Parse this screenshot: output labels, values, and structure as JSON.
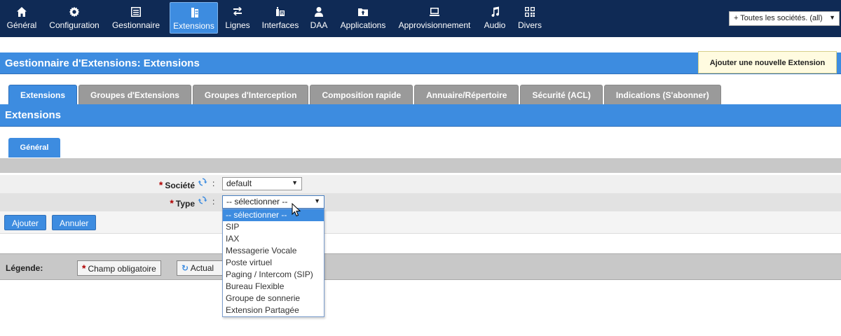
{
  "nav": {
    "items": [
      {
        "label": "Général",
        "icon": "home-icon"
      },
      {
        "label": "Configuration",
        "icon": "gear-icon"
      },
      {
        "label": "Gestionnaire",
        "icon": "list-icon"
      },
      {
        "label": "Extensions",
        "icon": "phone-icon",
        "active": true
      },
      {
        "label": "Lignes",
        "icon": "route-icon"
      },
      {
        "label": "Interfaces",
        "icon": "fax-icon"
      },
      {
        "label": "DAA",
        "icon": "user-icon"
      },
      {
        "label": "Applications",
        "icon": "folder-icon"
      },
      {
        "label": "Approvisionnement",
        "icon": "desk-phone-icon"
      },
      {
        "label": "Audio",
        "icon": "music-icon"
      },
      {
        "label": "Divers",
        "icon": "grid-icon"
      }
    ],
    "company_filter": "+ Toutes les sociétés. (all)"
  },
  "header": {
    "title": "Gestionnaire d'Extensions:  Extensions",
    "add_button": "Ajouter une nouvelle Extension"
  },
  "tabs": [
    {
      "label": "Extensions",
      "active": true
    },
    {
      "label": "Groupes d'Extensions"
    },
    {
      "label": "Groupes d'Interception"
    },
    {
      "label": "Composition rapide"
    },
    {
      "label": "Annuaire/Répertoire"
    },
    {
      "label": "Sécurité (ACL)"
    },
    {
      "label": "Indications (S'abonner)"
    }
  ],
  "section": {
    "title": "Extensions",
    "subtab": "Général"
  },
  "form": {
    "required_mark": "*",
    "colon": ":",
    "societe_label": "Société",
    "societe_value": "default",
    "type_label": "Type",
    "type_value": "-- sélectionner --"
  },
  "buttons": {
    "add": "Ajouter",
    "cancel": "Annuler"
  },
  "type_options": [
    "-- sélectionner --",
    "SIP",
    "IAX",
    "Messagerie Vocale",
    "Poste virtuel",
    "Paging / Intercom (SIP)",
    "Bureau Flexible",
    "Groupe de sonnerie",
    "Extension Partagée"
  ],
  "legend": {
    "label": "Légende:",
    "required": "Champ obligatoire",
    "refresh": "Actual"
  },
  "colors": {
    "topbar": "#0f2a55",
    "accent": "#3d8ce0",
    "required": "#b00000"
  }
}
